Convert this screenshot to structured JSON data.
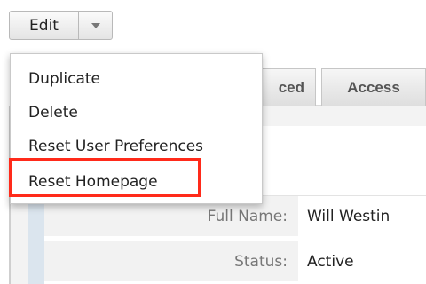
{
  "toolbar": {
    "edit_label": "Edit",
    "caret_icon": "chevron-down-icon"
  },
  "menu": {
    "items": [
      {
        "label": "Duplicate"
      },
      {
        "label": "Delete"
      },
      {
        "label": "Reset User Preferences"
      },
      {
        "label": "Reset Homepage"
      }
    ],
    "highlighted_index": 3,
    "highlight_color": "#ff2a1a"
  },
  "tabs": [
    {
      "label": "ced"
    },
    {
      "label": "Access"
    }
  ],
  "form": {
    "rows": [
      {
        "label": "Full Name:",
        "value": "Will Westin"
      },
      {
        "label": "Status:",
        "value": "Active"
      }
    ]
  }
}
